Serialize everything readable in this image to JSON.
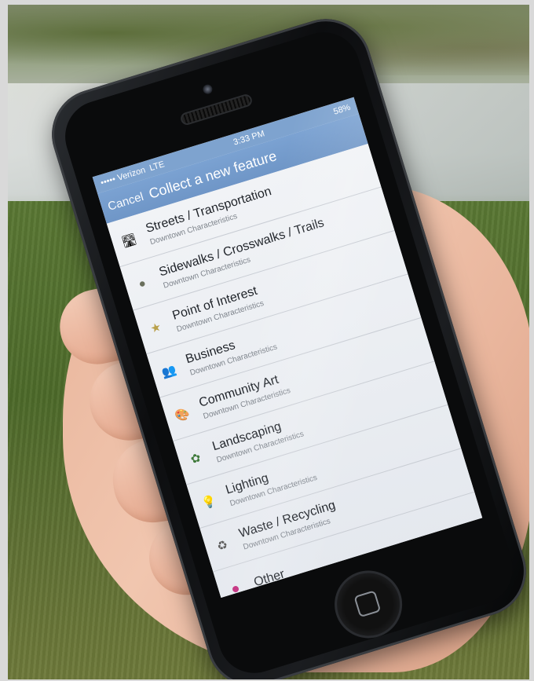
{
  "status_bar": {
    "carrier": "••••• Verizon",
    "network": "LTE",
    "time": "3:33 PM",
    "battery": "58%"
  },
  "nav": {
    "cancel_label": "Cancel",
    "title": "Collect a new feature"
  },
  "features": [
    {
      "icon": "road-icon",
      "glyph": "🛣",
      "title": "Streets / Transportation",
      "subtitle": "Downtown Characteristics"
    },
    {
      "icon": "sidewalk-icon",
      "glyph": "●",
      "title": "Sidewalks / Crosswalks / Trails",
      "subtitle": "Downtown Characteristics"
    },
    {
      "icon": "star-icon",
      "glyph": "★",
      "title": "Point of Interest",
      "subtitle": "Downtown Characteristics"
    },
    {
      "icon": "business-icon",
      "glyph": "👥",
      "title": "Business",
      "subtitle": "Downtown Characteristics"
    },
    {
      "icon": "art-icon",
      "glyph": "🎨",
      "title": "Community Art",
      "subtitle": "Downtown Characteristics"
    },
    {
      "icon": "plant-icon",
      "glyph": "✿",
      "title": "Landscaping",
      "subtitle": "Downtown Characteristics"
    },
    {
      "icon": "lightbulb-icon",
      "glyph": "💡",
      "title": "Lighting",
      "subtitle": "Downtown Characteristics"
    },
    {
      "icon": "recycle-icon",
      "glyph": "♻",
      "title": "Waste / Recycling",
      "subtitle": "Downtown Characteristics"
    },
    {
      "icon": "dot-icon",
      "glyph": "",
      "title": "Other",
      "subtitle": ""
    }
  ],
  "colors": {
    "nav_bar": "#7ba2d2",
    "other_dot": "#c2287b"
  }
}
